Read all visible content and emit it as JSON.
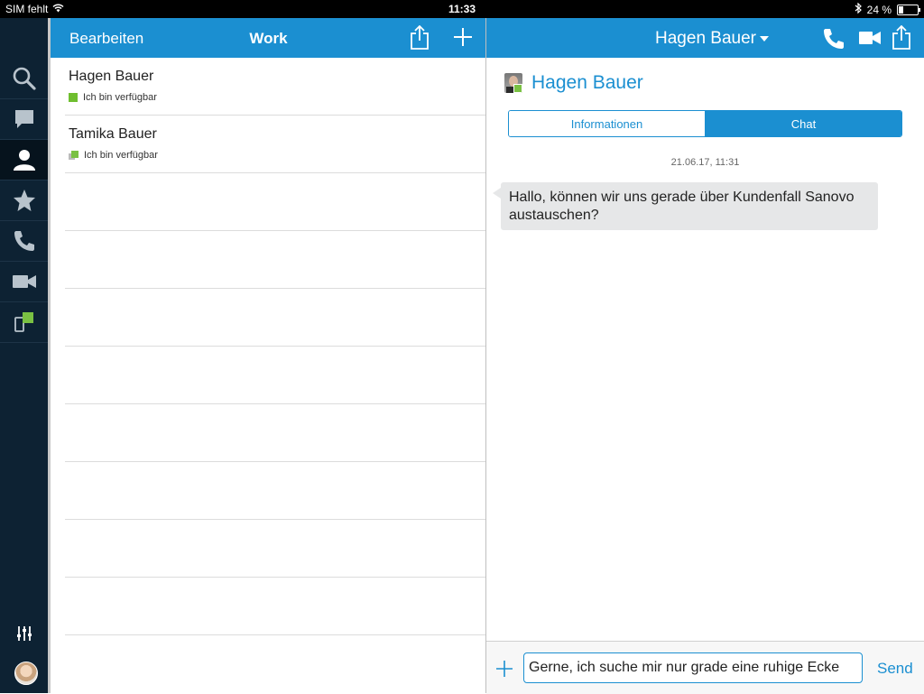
{
  "status_bar": {
    "carrier": "SIM fehlt",
    "time": "11:33",
    "battery": "24 %",
    "battery_level": 0.24
  },
  "list_panel": {
    "edit_label": "Bearbeiten",
    "title": "Work",
    "contacts": [
      {
        "name": "Hagen Bauer",
        "status": "Ich bin verfügbar"
      },
      {
        "name": "Tamika Bauer",
        "status": "Ich bin verfügbar"
      }
    ]
  },
  "chat_panel": {
    "contact_name": "Hagen Bauer",
    "profile_name": "Hagen Bauer",
    "tabs": {
      "info": "Informationen",
      "chat": "Chat",
      "active": "chat"
    },
    "timestamp": "21.06.17, 11:31",
    "message": "Hallo, können wir uns gerade über Kundenfall Sanovo austauschen?",
    "composer": {
      "text": "Gerne, ich suche mir nur grade eine ruhige Ecke",
      "send_label": "Send"
    }
  },
  "sidebar": {
    "items": [
      "search-icon",
      "chat-icon",
      "contacts-icon",
      "favorites-icon",
      "phone-icon",
      "video-icon",
      "device-presence-icon"
    ],
    "active": "contacts-icon"
  },
  "colors": {
    "accent": "#1b8fd1",
    "sidebar": "#0d2233",
    "presence": "#7ac143"
  }
}
